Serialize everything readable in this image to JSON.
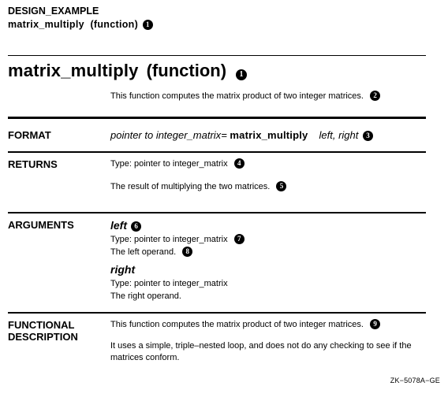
{
  "context": {
    "module": "DESIGN_EXAMPLE",
    "routine": "matrix_multiply",
    "routine_kind": "(function)"
  },
  "title": {
    "name": "matrix_multiply",
    "kind": "(function)"
  },
  "overview": "This function computes the matrix product of two integer matrices.",
  "format": {
    "label": "FORMAT",
    "return_type": "pointer to integer_matrix",
    "eq": "=",
    "name": "matrix_multiply",
    "args": "left, right"
  },
  "returns": {
    "label": "RETURNS",
    "type_prefix": "Type:  ",
    "type_value": "pointer to integer_matrix",
    "desc": "The result of multiplying the two matrices."
  },
  "arguments": {
    "label": "ARGUMENTS",
    "items": [
      {
        "name": "left",
        "type_prefix": "Type:  ",
        "type_value": "pointer to integer_matrix",
        "desc": "The left operand."
      },
      {
        "name": "right",
        "type_prefix": "Type:  ",
        "type_value": "pointer to integer_matrix",
        "desc": "The right operand."
      }
    ]
  },
  "functional": {
    "label_l1": "FUNCTIONAL",
    "label_l2": "DESCRIPTION",
    "p1": "This function computes the matrix product of two integer matrices.",
    "p2": "It uses a simple, triple–nested loop, and does not do any checking to see if the matrices conform."
  },
  "callouts": {
    "c1": "1",
    "c2": "2",
    "c3": "3",
    "c4": "4",
    "c5": "5",
    "c6": "6",
    "c7": "7",
    "c8": "8",
    "c9": "9"
  },
  "figure_id": "ZK−5078A−GE"
}
